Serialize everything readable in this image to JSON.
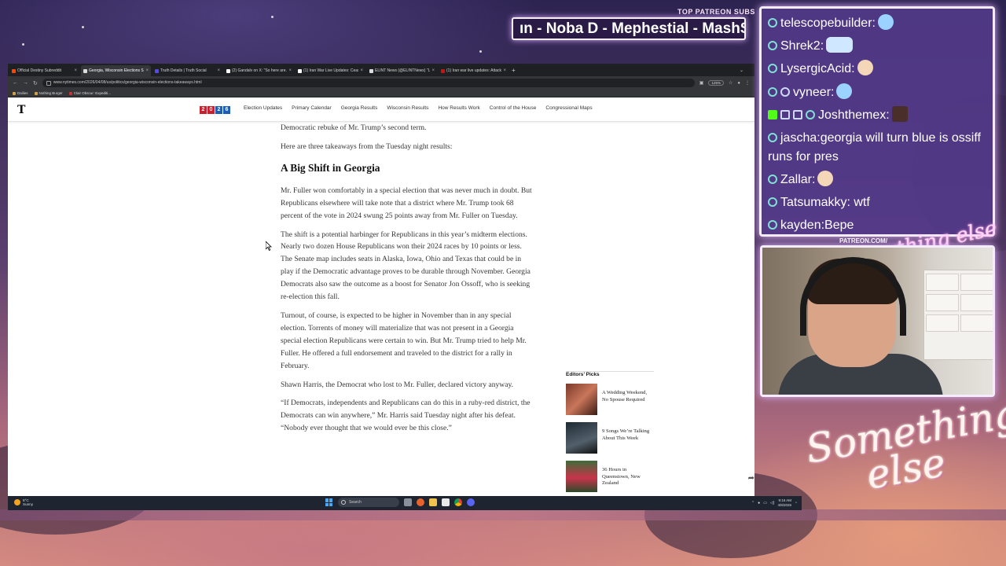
{
  "overlay": {
    "patreon_label": "TOP PATREON SUBS",
    "ticker_text": "ın - Noba D - Mephestial - MashS",
    "patreon_url": "PATREON.COM/",
    "cam_signature": "Anything else",
    "script_logo_line1": "Something",
    "script_logo_line2": "else"
  },
  "browser": {
    "tabs": [
      {
        "label": "Official Destiny Subreddit",
        "active": false,
        "color": "#ff4500"
      },
      {
        "label": "Georgia, Wisconsin Elections S...",
        "active": true,
        "color": "#dddddd"
      },
      {
        "label": "Truth Details | Truth Social",
        "active": false,
        "color": "#5448ee"
      },
      {
        "label": "(2) Gandalv on X: \"So here are...",
        "active": false,
        "color": "#ffffff"
      },
      {
        "label": "(1) Iran War Live Updates: Ceas...",
        "active": false,
        "color": "#ffffff"
      },
      {
        "label": "ELINT News (@ELINTNews) \"Li...",
        "active": false,
        "color": "#dddddd"
      },
      {
        "label": "(1) Iran war live updates: Attack...",
        "active": false,
        "color": "#cc1111"
      }
    ],
    "new_tab": "+",
    "url": "www.nytimes.com/2026/04/08/us/politics/georgia-wisconsin-elections-takeaways.html",
    "zoom": "125%",
    "bookmarks": [
      "Dailies",
      "Nothing Burger",
      "Clair Obscur: Expediti..."
    ]
  },
  "nyt": {
    "logo": "T",
    "badge": [
      "2",
      "0",
      "2",
      "6"
    ],
    "nav": [
      "Election Updates",
      "Primary Calendar",
      "Georgia Results",
      "Wisconsin Results",
      "How Results Work",
      "Control of the House",
      "Congressional Maps"
    ]
  },
  "article": {
    "p0": "Democratic rebuke of Mr. Trump’s second term.",
    "p1": "Here are three takeaways from the Tuesday night results:",
    "heading": "A Big Shift in Georgia",
    "p2": "Mr. Fuller won comfortably in a special election that was never much in doubt. But Republicans elsewhere will take note that a district where Mr. Trump took 68 percent of the vote in 2024 swung 25 points away from Mr. Fuller on Tuesday.",
    "p3": "The shift is a potential harbinger for Republicans in this year’s midterm elections. Nearly two dozen House Republicans won their 2024 races by 10 points or less. The Senate map includes seats in Alaska, Iowa, Ohio and Texas that could be in play if the Democratic advantage proves to be durable through November. Georgia Democrats also saw the outcome as a boost for Senator Jon Ossoff, who is seeking re-election this fall.",
    "p4": "Turnout, of course, is expected to be higher in November than in any special election. Torrents of money will materialize that was not present in a Georgia special election Republicans were certain to win. But Mr. Trump tried to help Mr. Fuller. He offered a full endorsement and traveled to the district for a rally in February.",
    "p5": "Shawn Harris, the Democrat who lost to Mr. Fuller, declared victory anyway.",
    "p6": "“If Democrats, independents and Republicans can do this in a ruby-red district, the Democrats can win anywhere,” Mr. Harris said Tuesday night after his defeat. “Nobody ever thought that we would ever be this close.”"
  },
  "editors_picks": {
    "title": "Editors’ Picks",
    "items": [
      {
        "label": "A Wedding Weekend, No Spouse Required",
        "color": "#7a3a2a"
      },
      {
        "label": "9 Songs We’re Talking About This Week",
        "color": "#1f2a33"
      },
      {
        "label": "36 Hours in Queenstown, New Zealand",
        "color": "#3f6b3a"
      }
    ]
  },
  "taskbar": {
    "weather_temp": "8°C",
    "weather_desc": "Sunny",
    "search": "Search",
    "time": "9:16 AM",
    "date": "4/8/2026"
  },
  "chat": [
    {
      "user": "telescopebuilder",
      "text": "",
      "emote": "#9bd2ff"
    },
    {
      "user": "Shrek2",
      "text": "",
      "emote": "#cfe7ff"
    },
    {
      "user": "LysergicAcid",
      "text": "",
      "emote": "#f3d7b8"
    },
    {
      "user": "vyneer",
      "text": "",
      "emote": "#9bd2ff"
    },
    {
      "user": "Joshthemex",
      "text": "",
      "emote": "#4a2e2a"
    },
    {
      "user": "jascha",
      "text": "georgia will turn blue is ossiff runs for pres",
      "emote": ""
    },
    {
      "user": "Zallar",
      "text": "",
      "emote": "#f3d7b8"
    },
    {
      "user": "Tatsumakky",
      "text": "wtf",
      "emote": ""
    },
    {
      "user": "kayden",
      "text": "Bepe",
      "emote": ""
    }
  ]
}
